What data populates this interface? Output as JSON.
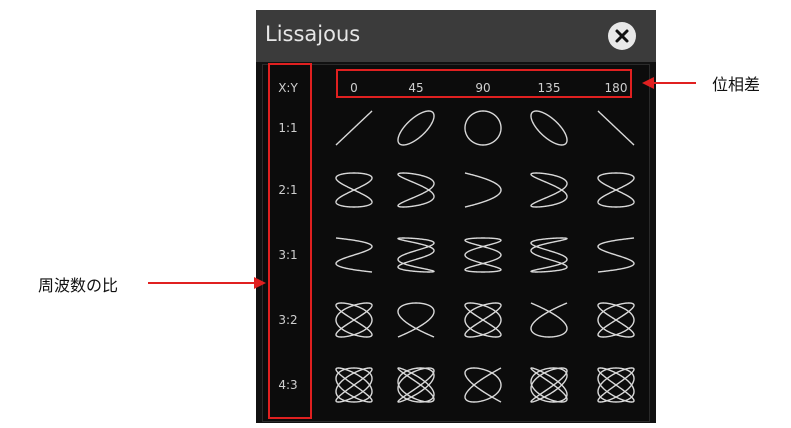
{
  "dialog": {
    "title": "Lissajous",
    "close_icon": "close-icon",
    "corner_label": "X:Y",
    "phase_labels": [
      "0",
      "45",
      "90",
      "135",
      "180"
    ],
    "ratio_labels": [
      "1:1",
      "2:1",
      "3:1",
      "3:2",
      "4:3"
    ]
  },
  "lissajous_rows": [
    {
      "ratio": "1:1",
      "a": 1,
      "b": 1
    },
    {
      "ratio": "2:1",
      "a": 1,
      "b": 2
    },
    {
      "ratio": "3:1",
      "a": 1,
      "b": 3
    },
    {
      "ratio": "3:2",
      "a": 2,
      "b": 3
    },
    {
      "ratio": "4:3",
      "a": 3,
      "b": 4
    }
  ],
  "phases_deg": [
    0,
    45,
    90,
    135,
    180
  ],
  "annotations": {
    "phase": "位相差",
    "frequency_ratio": "周波数の比"
  },
  "colors": {
    "highlight": "#e02020",
    "curve": "#d9d9d9"
  }
}
